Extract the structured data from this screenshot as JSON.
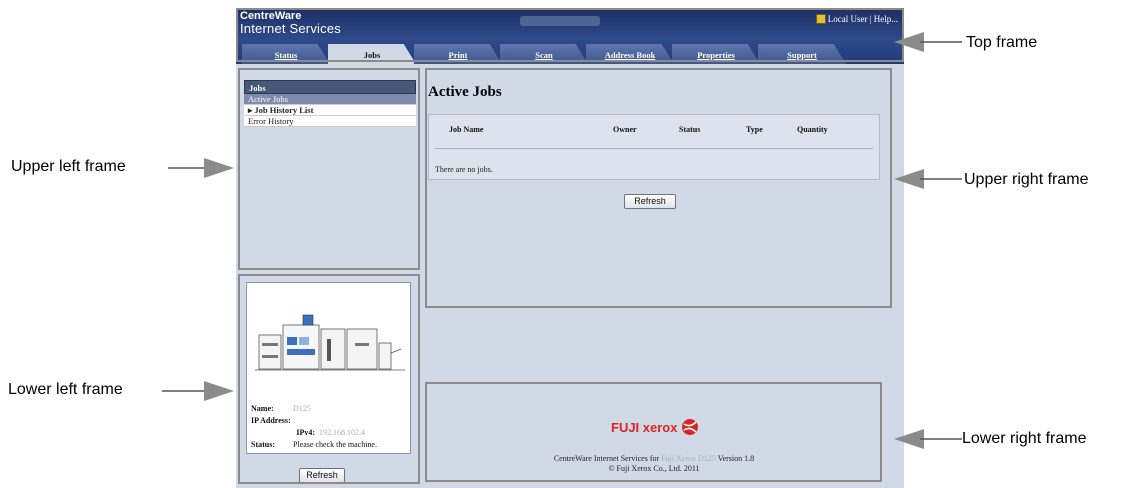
{
  "app": {
    "brand_line1": "CentreWare",
    "brand_line2": "Internet Services",
    "user_link": "Local User | Help...",
    "tabs": [
      {
        "label": "Status"
      },
      {
        "label": "Jobs"
      },
      {
        "label": "Print"
      },
      {
        "label": "Scan"
      },
      {
        "label": "Address Book"
      },
      {
        "label": "Properties"
      },
      {
        "label": "Support"
      }
    ],
    "active_tab": "Jobs"
  },
  "sidebar": {
    "title": "Jobs",
    "items": [
      {
        "label": "Active Jobs",
        "selected": true
      },
      {
        "label": "Job History List",
        "expandable": true
      },
      {
        "label": "Error History"
      }
    ]
  },
  "device_panel": {
    "name_label": "Name:",
    "name_value": "D125",
    "ip_label": "IP Address:",
    "ipv4_label": "IPv4:",
    "ipv4_value": "192.168.102.4",
    "status_label": "Status:",
    "status_value": "Please check the machine.",
    "refresh_label": "Refresh"
  },
  "main": {
    "title": "Active Jobs",
    "columns": [
      "Job Name",
      "Owner",
      "Status",
      "Type",
      "Quantity"
    ],
    "empty_message": "There are no jobs.",
    "refresh_label": "Refresh"
  },
  "footer": {
    "logo_text": "FUJI xerox",
    "line1_prefix": "CentreWare Internet Services for",
    "line1_model": "Fuji Xerox D125",
    "line1_suffix": "Version 1.8",
    "line2": "© Fuji Xerox Co., Ltd. 2011"
  },
  "annotations": {
    "top_frame": "Top frame",
    "upper_left_frame": "Upper left frame",
    "upper_right_frame": "Upper right frame",
    "lower_left_frame": "Lower left frame",
    "lower_right_frame": "Lower right frame"
  },
  "colors": {
    "header_bg": "#2e4a8a",
    "frame_border": "#8b8b8b",
    "page_bg": "#d2d9e6",
    "xerox_red": "#d6261f"
  }
}
